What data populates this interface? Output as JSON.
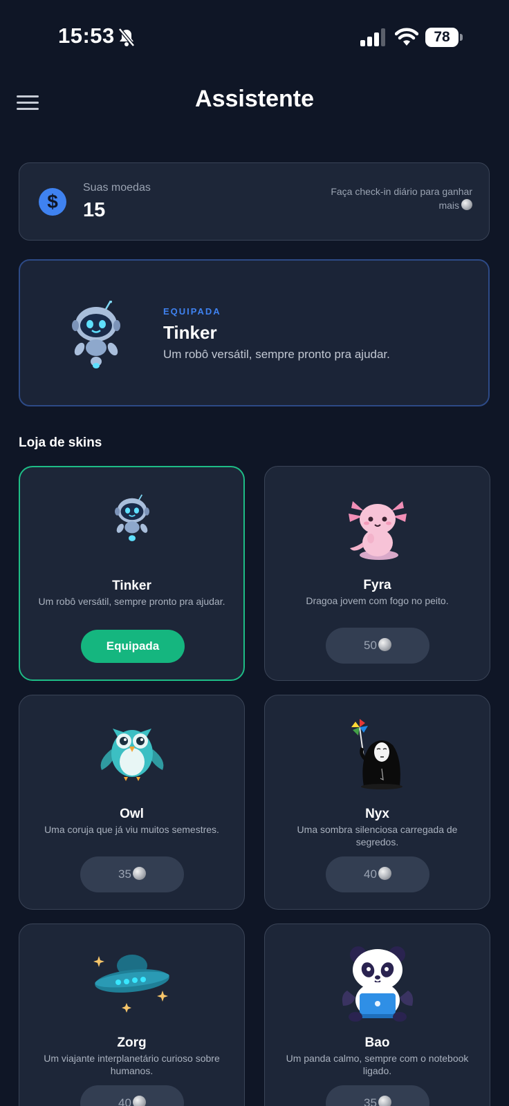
{
  "status_bar": {
    "time": "15:53",
    "battery": "78"
  },
  "header": {
    "title": "Assistente"
  },
  "coins": {
    "label": "Suas moedas",
    "value": "15",
    "hint": "Faça check-in diário para ganhar mais"
  },
  "equipped": {
    "badge": "EQUIPADA",
    "name": "Tinker",
    "description": "Um robô versátil, sempre pronto pra ajudar."
  },
  "shop": {
    "title": "Loja de skins",
    "skins": [
      {
        "name": "Tinker",
        "description": "Um robô versátil, sempre pronto pra ajudar.",
        "button": "Equipada",
        "icon": "robot-icon"
      },
      {
        "name": "Fyra",
        "description": "Dragoa jovem com fogo no peito.",
        "price": "50",
        "icon": "axolotl-icon"
      },
      {
        "name": "Owl",
        "description": "Uma coruja que já viu muitos semestres.",
        "price": "35",
        "icon": "owl-icon"
      },
      {
        "name": "Nyx",
        "description": "Uma sombra silenciosa carregada de segredos.",
        "price": "40",
        "icon": "shadow-spirit-icon"
      },
      {
        "name": "Zorg",
        "description": "Um viajante interplanetário curioso sobre humanos.",
        "price": "40",
        "icon": "ufo-icon"
      },
      {
        "name": "Bao",
        "description": "Um panda calmo, sempre com o notebook ligado.",
        "price": "35",
        "icon": "panda-icon"
      }
    ]
  },
  "colors": {
    "background": "#0f1626",
    "card": "#1d2638",
    "accent_blue": "#3f82f0",
    "accent_green": "#15b67f"
  }
}
